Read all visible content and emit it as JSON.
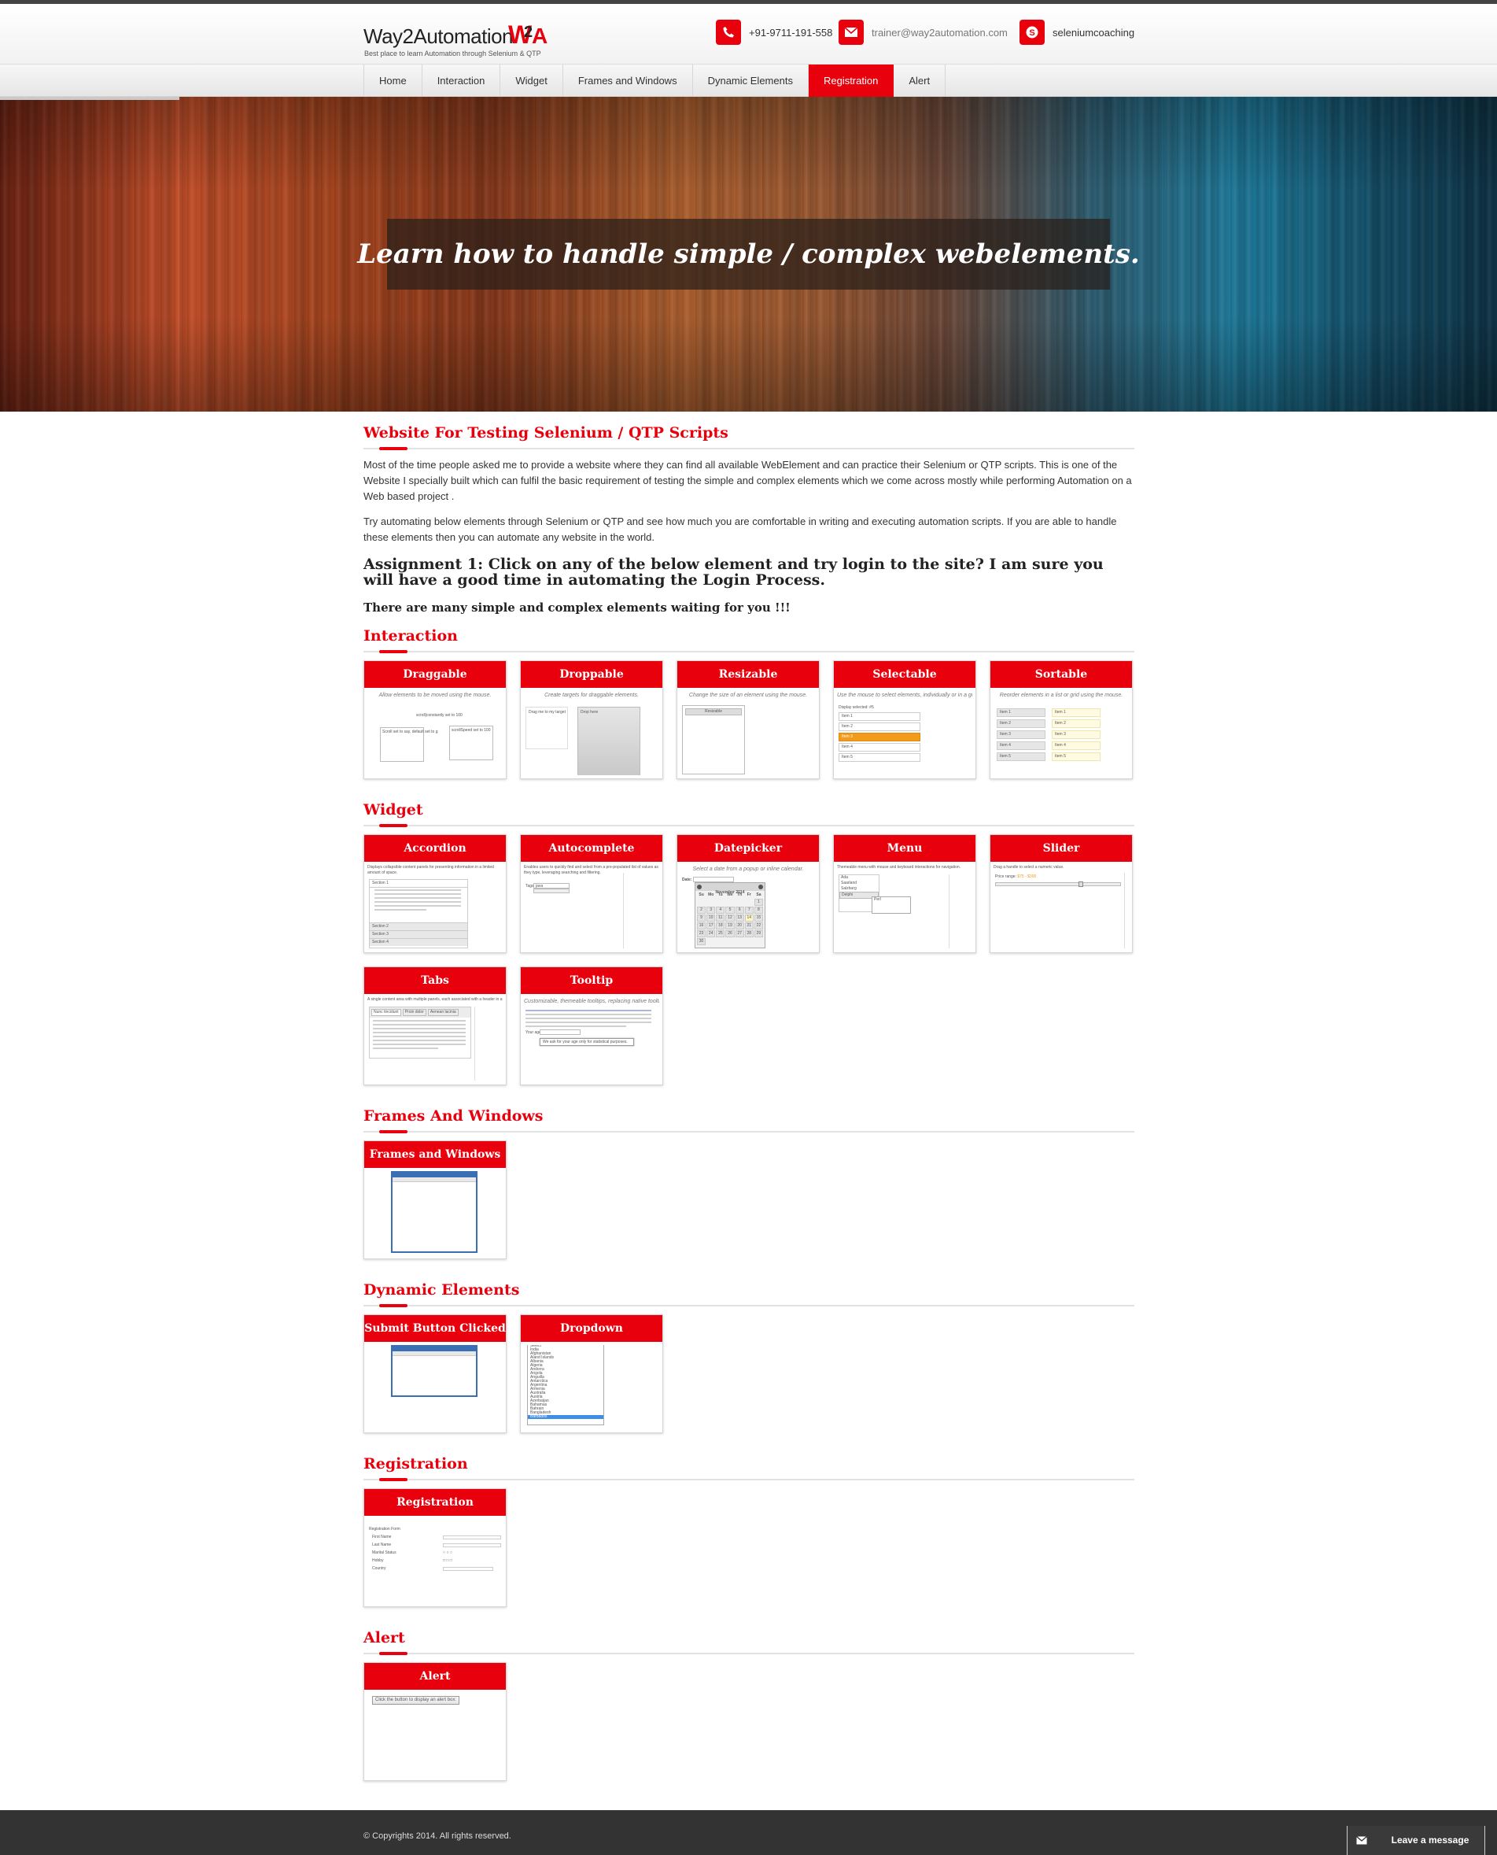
{
  "brand": {
    "name": "Way2Automation",
    "mark": "W2A",
    "tagline": "Best place to learn Automation through Selenium & QTP"
  },
  "contacts": {
    "phone": "+91-9711-191-558",
    "email": "trainer@way2automation.com",
    "skype": "seleniumcoaching"
  },
  "nav": {
    "items": [
      {
        "label": "Home"
      },
      {
        "label": "Interaction"
      },
      {
        "label": "Widget"
      },
      {
        "label": "Frames and Windows"
      },
      {
        "label": "Dynamic Elements"
      },
      {
        "label": "Registration"
      },
      {
        "label": "Alert"
      }
    ],
    "active": "Registration"
  },
  "hero": {
    "title": "Learn how to handle simple / complex webelements."
  },
  "intro": {
    "heading": "Website For Testing Selenium / QTP Scripts",
    "para1": "Most of the time people asked me to provide a website where they can find all available WebElement and can practice their Selenium or QTP scripts. This is one of the Website I specially built which can fulfil the basic requirement of testing the simple and complex elements which we come across mostly while performing Automation on a Web based project .",
    "para2": "Try automating below elements through Selenium or QTP and see how much you are comfortable in writing and executing automation scripts. If you are able to handle these elements then you can automate any website in the world.",
    "assignment": "Assignment 1: Click on any of the below element and try login to the site? I am sure you will have a good time in automating the Login Process.",
    "subline": "There are many simple and complex elements waiting for you !!!"
  },
  "sections": {
    "interaction": {
      "heading": "Interaction",
      "cards": [
        {
          "title": "Draggable",
          "caption": "Allow elements to be moved using the mouse.",
          "t1": "scroll|constantly set to 100",
          "t2": "Scroll set to say, default set to g",
          "t3": "scrollSpeed set to 100"
        },
        {
          "title": "Droppable",
          "caption": "Create targets for draggable elements.",
          "t1": "Drag me to my target",
          "t2": "Drop here"
        },
        {
          "title": "Resizable",
          "caption": "Change the size of an element using the mouse.",
          "t1": "Resizable"
        },
        {
          "title": "Selectable",
          "caption": "Use the mouse to select elements, individually or in a group.",
          "t1": "Display selected: #5",
          "items": [
            "Item 1",
            "Item 2",
            "Item 3",
            "Item 4",
            "Item 5"
          ]
        },
        {
          "title": "Sortable",
          "caption": "Reorder elements in a list or grid using the mouse.",
          "items": [
            "Item 1",
            "Item 2",
            "Item 3",
            "Item 4",
            "Item 5"
          ]
        }
      ]
    },
    "widget": {
      "heading": "Widget",
      "cards": [
        {
          "title": "Accordion",
          "caption": "Displays collapsible content panels for presenting information in a limited amount of space.",
          "items": [
            "Section 1",
            "Section 2",
            "Section 3",
            "Section 4"
          ]
        },
        {
          "title": "Autocomplete",
          "caption": "Enables users to quickly find and select from a pre-populated list of values as they type, leveraging searching and filtering.",
          "t1": "Tags:",
          "t2": "java"
        },
        {
          "title": "Datepicker",
          "caption": "Select a date from a popup or inline calendar.",
          "t1": "Date:",
          "month": "November 2014",
          "days": [
            "Su",
            "Mo",
            "Tu",
            "We",
            "Th",
            "Fr",
            "Sa"
          ],
          "weeks": [
            [
              "",
              "",
              "",
              "",
              "",
              "",
              "1"
            ],
            [
              "2",
              "3",
              "4",
              "5",
              "6",
              "7",
              "8"
            ],
            [
              "9",
              "10",
              "11",
              "12",
              "13",
              "14",
              "15"
            ],
            [
              "16",
              "17",
              "18",
              "19",
              "20",
              "21",
              "22"
            ],
            [
              "23",
              "24",
              "25",
              "26",
              "27",
              "28",
              "29"
            ],
            [
              "30",
              "",
              "",
              "",
              "",
              "",
              ""
            ]
          ]
        },
        {
          "title": "Menu",
          "caption": "Themeable menu with mouse and keyboard interactions for navigation.",
          "items": [
            "Ada",
            "Saarland",
            "Salzburg",
            "Delphi",
            "Perl"
          ]
        },
        {
          "title": "Slider",
          "caption": "Drag a handle to select a numeric value.",
          "t1": "Price range:",
          "t2": "$75 - $300"
        },
        {
          "title": "Tabs",
          "caption": "A single content area with multiple panels, each associated with a header in a list.",
          "tabs": [
            "Nunc tincidunt",
            "Proin dolor",
            "Aenean lacinia"
          ]
        },
        {
          "title": "Tooltip",
          "caption": "Customizable, themeable tooltips, replacing native tooltips.",
          "t1": "Your age:",
          "t2": "We ask for your age only for statistical purposes."
        }
      ]
    },
    "frames": {
      "heading": "Frames And Windows",
      "cards": [
        {
          "title": "Frames and Windows"
        }
      ]
    },
    "dynamic": {
      "heading": "Dynamic Elements",
      "cards": [
        {
          "title": "Submit Button Clicked"
        },
        {
          "title": "Dropdown",
          "items": [
            "Select",
            "India",
            "Afghanistan",
            "Aland Islands",
            "Albania",
            "Algeria",
            "Andorra",
            "Angola",
            "Anguilla",
            "Antarctica",
            "Argentina",
            "Armenia",
            "Australia",
            "Austria",
            "Azerbaijan",
            "Bahamas",
            "Bahrain",
            "Bangladesh",
            "Barbados"
          ]
        }
      ]
    },
    "registration": {
      "heading": "Registration",
      "cards": [
        {
          "title": "Registration",
          "t1": "Registration Form",
          "fields": [
            "First Name",
            "Last Name",
            "Marital Status",
            "Hobby",
            "Country"
          ]
        }
      ]
    },
    "alert": {
      "heading": "Alert",
      "cards": [
        {
          "title": "Alert",
          "t1": "Click the button to display an alert box:"
        }
      ]
    }
  },
  "footer": {
    "copyright": "© Copyrights 2014. All rights reserved.",
    "chat_label": "Leave a message"
  },
  "colors": {
    "accent": "#e8000d",
    "footer": "#333333",
    "highlight": "#f29a1b"
  }
}
